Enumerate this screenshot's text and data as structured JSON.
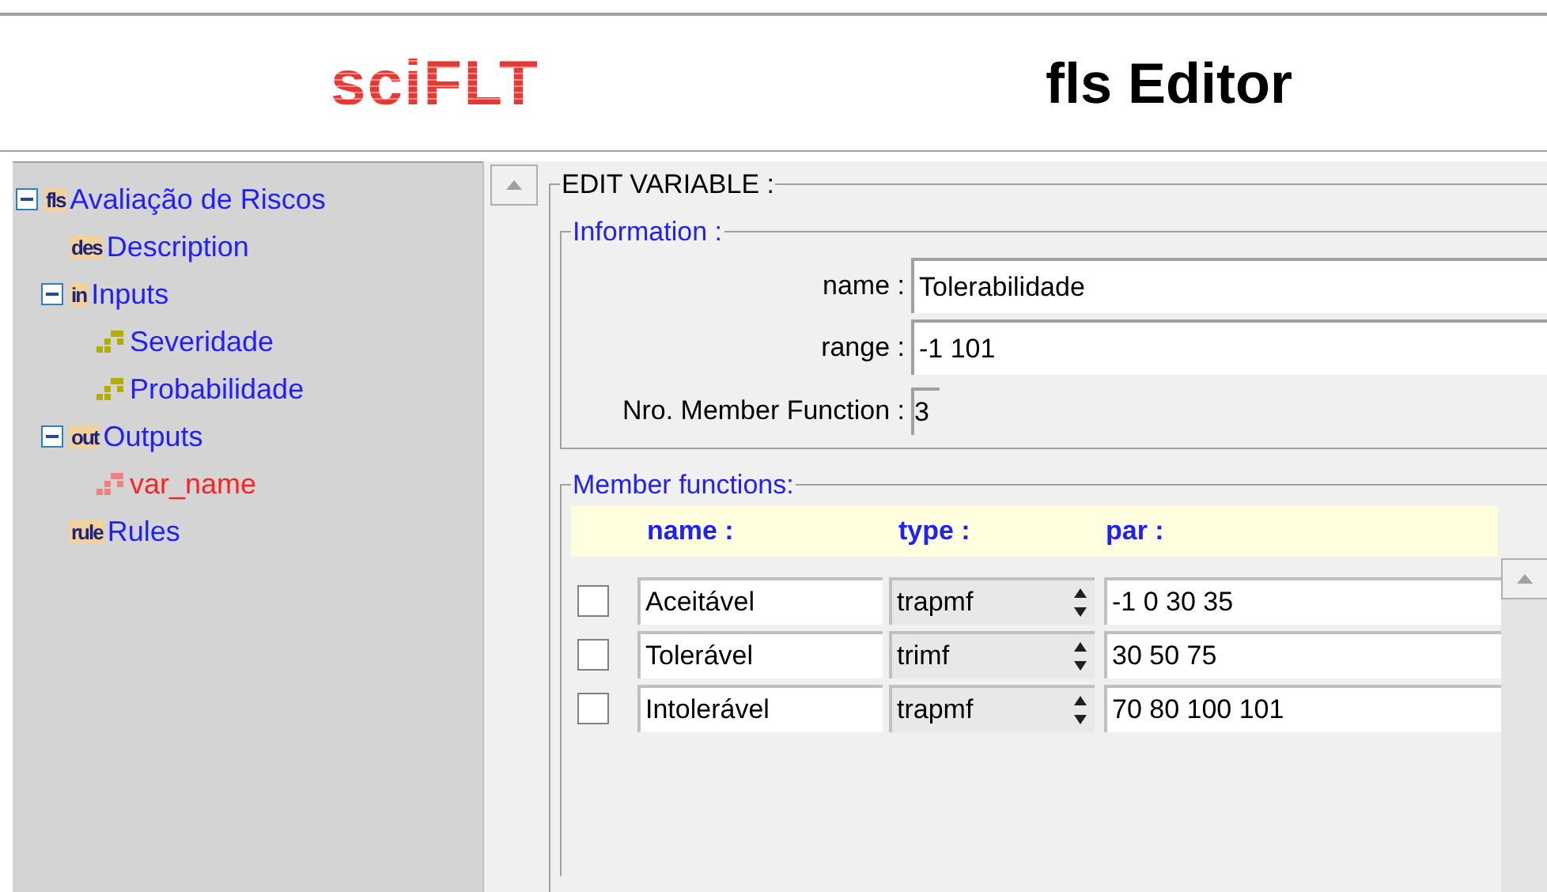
{
  "header": {
    "logo": "sciFLT",
    "title": "fls Editor"
  },
  "tree": [
    {
      "kind": "group",
      "label": "Avaliação de Riscos",
      "badge": "fls",
      "expanded": true,
      "selected": false,
      "children": [
        {
          "kind": "group",
          "label": "Description",
          "badge": "des",
          "selected": false
        },
        {
          "kind": "group",
          "label": "Inputs",
          "badge": "in",
          "expanded": true,
          "selected": false,
          "children": [
            {
              "kind": "variable",
              "label": "Severidade",
              "color": "#b3ad00",
              "selected": false
            },
            {
              "kind": "variable",
              "label": "Probabilidade",
              "color": "#b3ad00",
              "selected": false
            }
          ]
        },
        {
          "kind": "group",
          "label": "Outputs",
          "badge": "out",
          "expanded": true,
          "selected": false,
          "children": [
            {
              "kind": "variable",
              "label": "var_name",
              "color": "#f08080",
              "selected": true
            }
          ]
        },
        {
          "kind": "group",
          "label": "Rules",
          "badge": "rule",
          "selected": false
        }
      ]
    }
  ],
  "editor": {
    "section": "EDIT VARIABLE :",
    "information": {
      "legend": "Information :",
      "fields": [
        {
          "label": "name :",
          "value": "Tolerabilidade"
        },
        {
          "label": "range :",
          "value": "-1 101"
        }
      ],
      "mf_count": {
        "label": "Nro. Member Function :",
        "value": "3"
      }
    },
    "member_functions": {
      "legend": "Member functions:",
      "columns": [
        "name :",
        "type :",
        "par :"
      ],
      "rows": [
        {
          "checked": false,
          "name": "Aceitável",
          "type": "trapmf",
          "par": "-1 0 30 35"
        },
        {
          "checked": false,
          "name": "Tolerável",
          "type": "trimf",
          "par": "30 50 75"
        },
        {
          "checked": false,
          "name": "Intolerável",
          "type": "trapmf",
          "par": "70 80 100 101"
        }
      ]
    }
  }
}
